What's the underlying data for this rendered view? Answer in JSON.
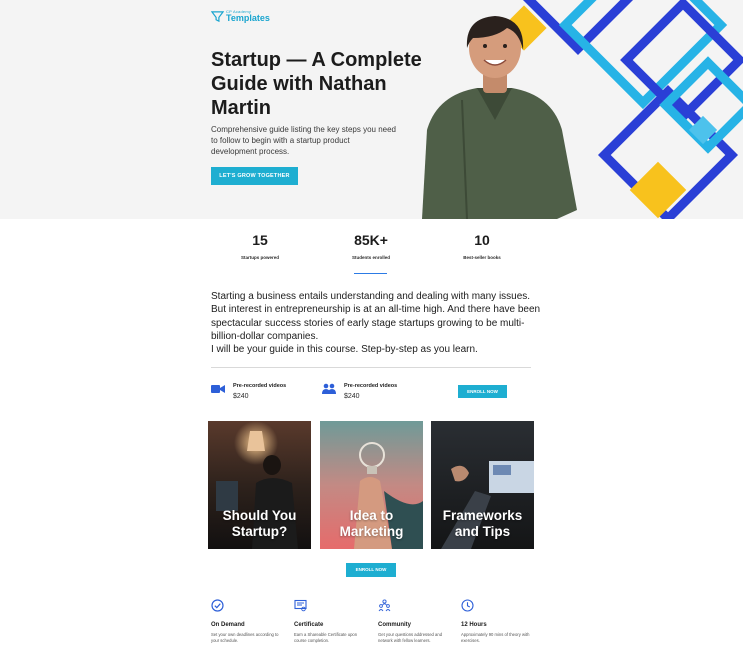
{
  "brand": {
    "small": "CP Academy",
    "name": "Templates",
    "accent": "#1eaed1"
  },
  "hero": {
    "title": "Startup — A Complete Guide with Nathan Martin",
    "description": "Comprehensive guide listing the key steps you need to follow to begin with a startup product development process.",
    "cta": "LET'S GROW TOGETHER"
  },
  "stats": [
    {
      "value": "15",
      "label": "Startups powered"
    },
    {
      "value": "85K+",
      "label": "Students enrolled"
    },
    {
      "value": "10",
      "label": "Best-seller books"
    }
  ],
  "intro": "Starting a business entails understanding and dealing with many issues. But interest in entrepreneurship is at an all-time high. And there have been spectacular success stories of early stage startups growing to be multi-billion-dollar companies.\nI will be your guide in this course. Step-by-step as you learn.",
  "offers": [
    {
      "icon": "video-camera-icon",
      "title": "Pre-recorded videos",
      "price": "$240"
    },
    {
      "icon": "people-icon",
      "title": "Pre-recorded videos",
      "price": "$240"
    }
  ],
  "enroll_label": "ENROLL NOW",
  "cards": [
    {
      "title": "Should You Startup?"
    },
    {
      "title": "Idea to Marketing"
    },
    {
      "title": "Frameworks and Tips"
    }
  ],
  "features": [
    {
      "icon": "check-circle-icon",
      "title": "On Demand",
      "desc": "Set your own deadlines according to your schedule."
    },
    {
      "icon": "certificate-icon",
      "title": "Certificate",
      "desc": "Earn a Shareable Certificate upon course completion."
    },
    {
      "icon": "community-icon",
      "title": "Community",
      "desc": "Get your questions addressed and network with fellow learners."
    },
    {
      "icon": "clock-icon",
      "title": "12 Hours",
      "desc": "Approximately 90 mins of theory with exercises."
    }
  ]
}
